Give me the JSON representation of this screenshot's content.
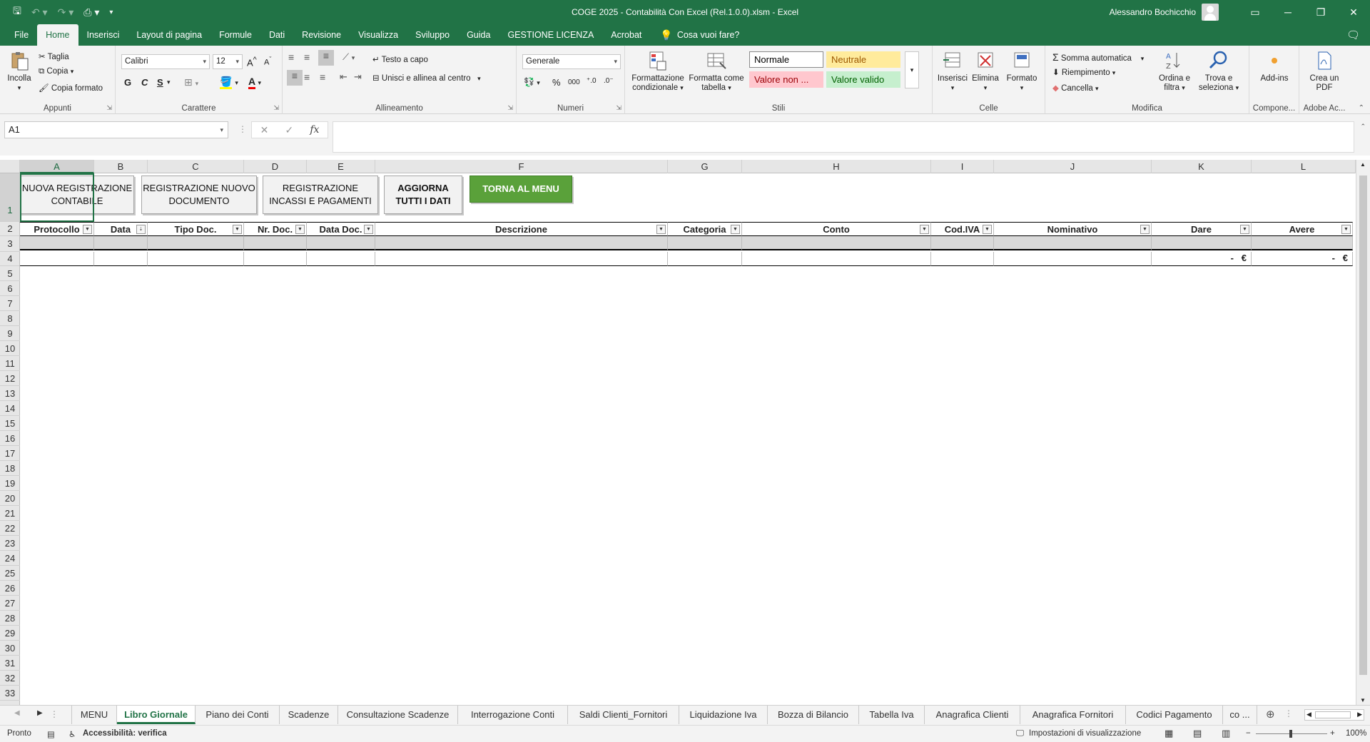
{
  "titlebar": {
    "title": "COGE 2025 - Contabilità Con Excel (Rel.1.0.0).xlsm  -  Excel",
    "user": "Alessandro Bochicchio"
  },
  "tabs": [
    "File",
    "Home",
    "Inserisci",
    "Layout di pagina",
    "Formule",
    "Dati",
    "Revisione",
    "Visualizza",
    "Sviluppo",
    "Guida",
    "GESTIONE LICENZA",
    "Acrobat"
  ],
  "tell_me": "Cosa vuoi fare?",
  "ribbon": {
    "appunti": {
      "label": "Appunti",
      "incolla": "Incolla",
      "taglia": "Taglia",
      "copia": "Copia",
      "copia_formato": "Copia formato"
    },
    "carattere": {
      "label": "Carattere",
      "font": "Calibri",
      "size": "12",
      "bold": "G",
      "italic": "C",
      "underline": "S"
    },
    "allineamento": {
      "label": "Allineamento",
      "wrap": "Testo a capo",
      "merge": "Unisci e allinea al centro"
    },
    "numeri": {
      "label": "Numeri",
      "format": "Generale",
      "percent": "%",
      "thousands": "000"
    },
    "stili": {
      "label": "Stili",
      "cond_format": "Formattazione condizionale",
      "format_table": "Formatta come tabella",
      "styles": [
        {
          "name": "Normale",
          "bg": "#ffffff",
          "fg": "#000000"
        },
        {
          "name": "Neutrale",
          "bg": "#ffeb9c",
          "fg": "#9c5700"
        },
        {
          "name": "Valore non ...",
          "bg": "#ffc7ce",
          "fg": "#9c0006"
        },
        {
          "name": "Valore valido",
          "bg": "#c6efce",
          "fg": "#006100"
        }
      ]
    },
    "celle": {
      "label": "Celle",
      "inserisci": "Inserisci",
      "elimina": "Elimina",
      "formato": "Formato"
    },
    "modifica": {
      "label": "Modifica",
      "somma": "Somma automatica",
      "riempimento": "Riempimento",
      "cancella": "Cancella",
      "ordina": "Ordina e filtra",
      "trova": "Trova e seleziona"
    },
    "componenti": {
      "label": "Compone...",
      "addins": "Add-ins"
    },
    "adobe": {
      "label": "Adobe Ac...",
      "crea_pdf": "Crea un PDF"
    }
  },
  "formula_bar": {
    "name_box": "A1",
    "fx": "fx",
    "value": ""
  },
  "columns": [
    "A",
    "B",
    "C",
    "D",
    "E",
    "F",
    "G",
    "H",
    "I",
    "J",
    "K",
    "L"
  ],
  "rows": [
    "1",
    "2",
    "3",
    "4",
    "5",
    "6",
    "7",
    "8",
    "9",
    "10",
    "11",
    "12",
    "13",
    "14",
    "15",
    "16",
    "17",
    "18",
    "19",
    "20",
    "21",
    "22",
    "23",
    "24",
    "25",
    "26",
    "27",
    "28",
    "29",
    "30",
    "31",
    "32",
    "33"
  ],
  "sheet_buttons": {
    "nuova_registrazione": "NUOVA REGISTRAZIONE CONTABILE",
    "registrazione_documento": "REGISTRAZIONE NUOVO DOCUMENTO",
    "registrazione_incassi": "REGISTRAZIONE INCASSI E PAGAMENTI",
    "aggiorna": "AGGIORNA TUTTI I DATI",
    "torna_menu": "TORNA AL MENU"
  },
  "table_headers": [
    "Protocollo",
    "Data",
    "Tipo Doc.",
    "Nr. Doc.",
    "Data Doc.",
    "Descrizione",
    "Categoria",
    "Conto",
    "Cod.IVA",
    "Nominativo",
    "Dare",
    "Avere"
  ],
  "row4": {
    "dare": "-   €",
    "avere": "-   €"
  },
  "sheet_tabs": [
    "MENU",
    "Libro Giornale",
    "Piano dei Conti",
    "Scadenze",
    "Consultazione Scadenze",
    "Interrogazione Conti",
    "Saldi Clienti_Fornitori",
    "Liquidazione Iva",
    "Bozza di Bilancio",
    "Tabella Iva",
    "Anagrafica Clienti",
    "Anagrafica Fornitori",
    "Codici Pagamento",
    "co ..."
  ],
  "active_sheet": "Libro Giornale",
  "statusbar": {
    "ready": "Pronto",
    "accessibility": "Accessibilità: verifica",
    "view_settings": "Impostazioni di visualizzazione",
    "zoom": "100%"
  },
  "colors": {
    "excel_green": "#217346",
    "button_green": "#5aa13a",
    "row3_gray": "#d9d9d9"
  }
}
